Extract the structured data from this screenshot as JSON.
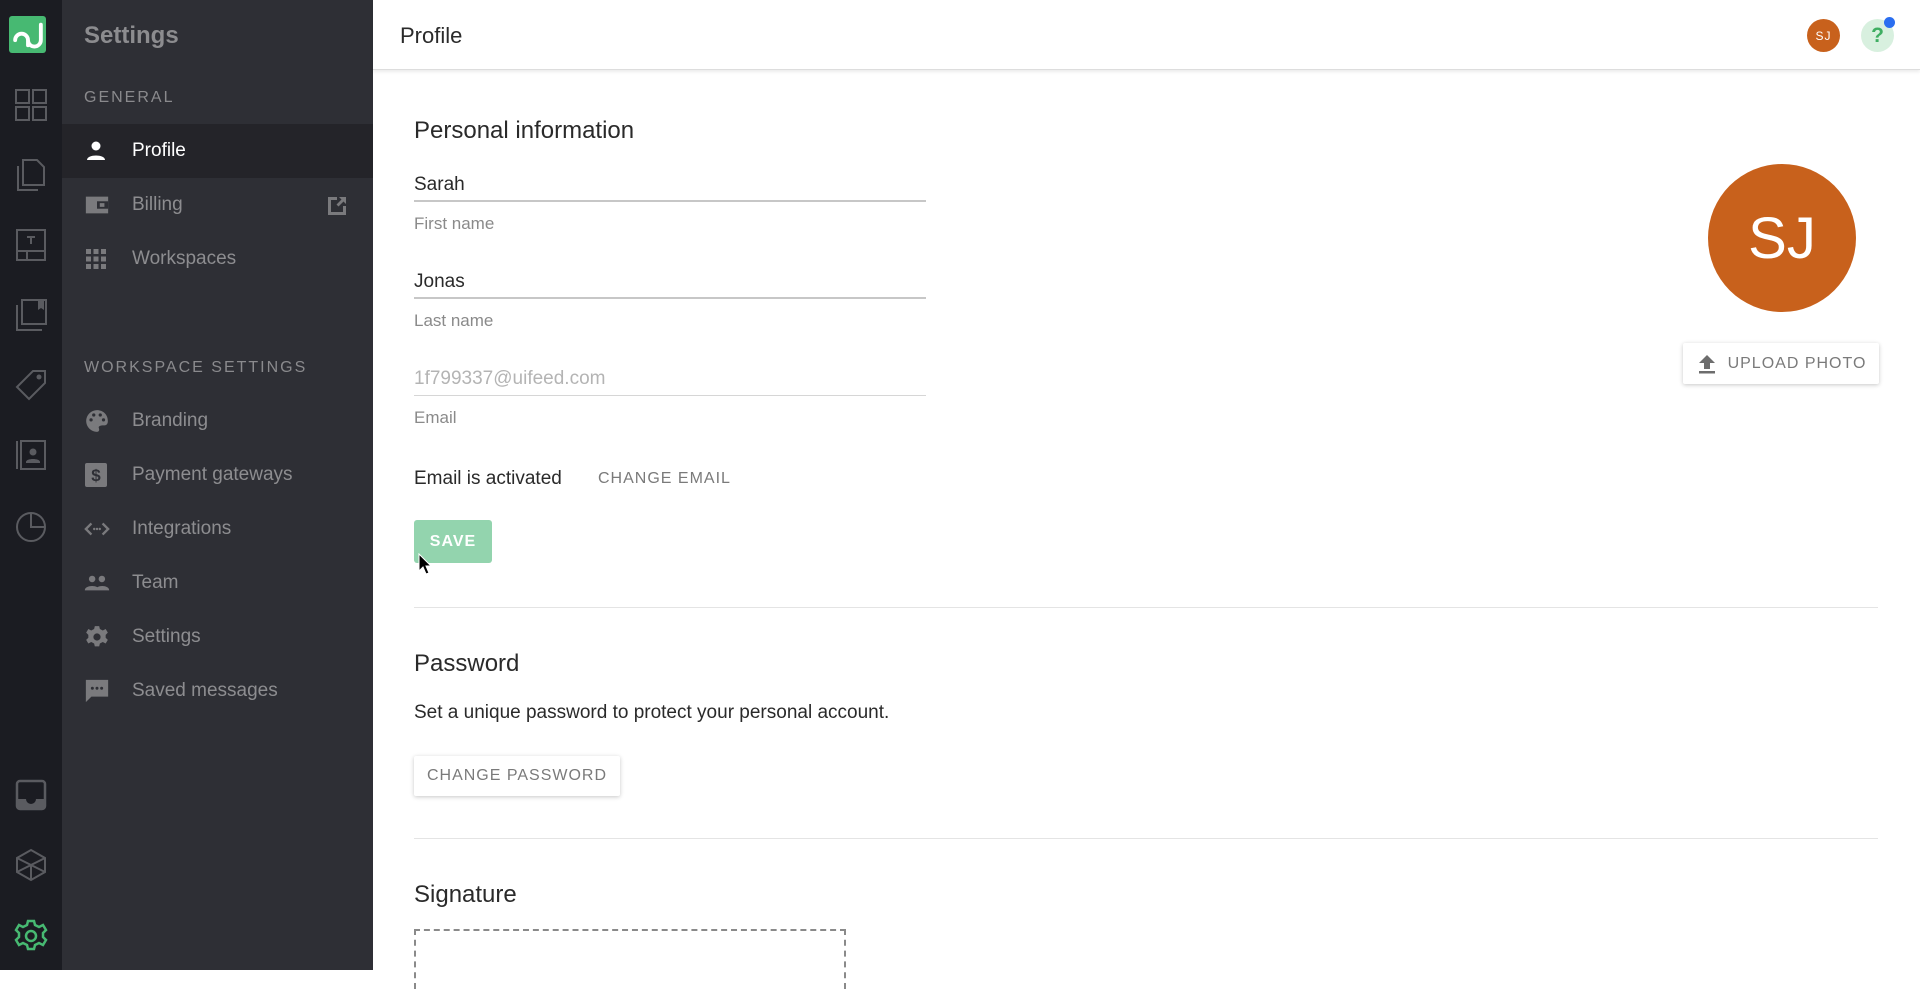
{
  "rail": {
    "logo": "pd-logo",
    "icons": [
      "dashboard-icon",
      "documents-icon",
      "templates-icon",
      "content-library-icon",
      "catalog-icon",
      "contacts-icon",
      "reports-icon",
      "inbox-icon",
      "integrations-icon",
      "settings-icon"
    ],
    "active": "settings-icon",
    "accent": "#47b972"
  },
  "sidebar": {
    "title": "Settings",
    "general_header": "GENERAL",
    "general_items": [
      {
        "label": "Profile",
        "icon": "person-icon",
        "active": true
      },
      {
        "label": "Billing",
        "icon": "wallet-icon",
        "external": true
      },
      {
        "label": "Workspaces",
        "icon": "grid-icon"
      }
    ],
    "workspace_header": "WORKSPACE SETTINGS",
    "workspace_items": [
      {
        "label": "Branding",
        "icon": "palette-icon"
      },
      {
        "label": "Payment gateways",
        "icon": "dollar-icon"
      },
      {
        "label": "Integrations",
        "icon": "code-icon"
      },
      {
        "label": "Team",
        "icon": "people-icon"
      },
      {
        "label": "Settings",
        "icon": "gear-icon"
      },
      {
        "label": "Saved messages",
        "icon": "message-icon"
      }
    ]
  },
  "header": {
    "title": "Profile",
    "avatar_initials": "SJ",
    "help_label": "?"
  },
  "personal": {
    "title": "Personal information",
    "first_name": {
      "value": "Sarah",
      "label": "First name"
    },
    "last_name": {
      "value": "Jonas",
      "label": "Last name"
    },
    "email": {
      "value": "1f799337@uifeed.com",
      "label": "Email"
    },
    "email_status": "Email is activated",
    "change_email": "CHANGE EMAIL",
    "save": "SAVE",
    "avatar_initials": "SJ",
    "upload_photo": "UPLOAD PHOTO",
    "avatar_color": "#c8611c"
  },
  "password": {
    "title": "Password",
    "description": "Set a unique password to protect your personal account.",
    "change_password": "CHANGE PASSWORD"
  },
  "signature": {
    "title": "Signature"
  }
}
